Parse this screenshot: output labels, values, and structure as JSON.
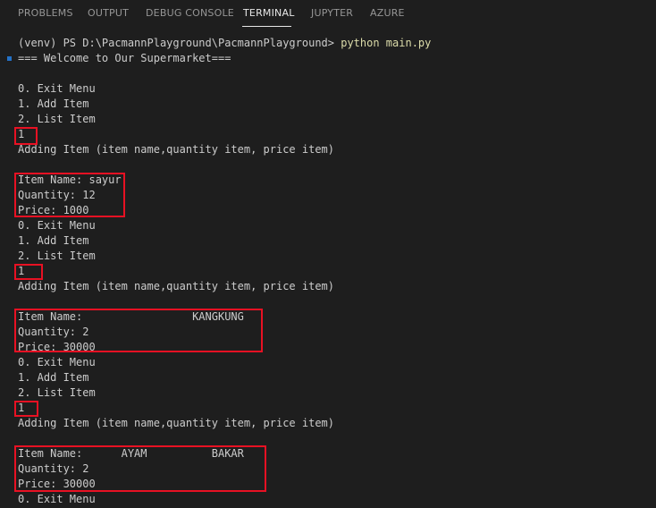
{
  "tabs": [
    {
      "label": "PROBLEMS",
      "active": false
    },
    {
      "label": "OUTPUT",
      "active": false
    },
    {
      "label": "DEBUG CONSOLE",
      "active": false
    },
    {
      "label": "TERMINAL",
      "active": true
    },
    {
      "label": "JUPYTER",
      "active": false
    },
    {
      "label": "AZURE",
      "active": false
    }
  ],
  "terminal": {
    "prompt": "(venv) PS D:\\PacmannPlayground\\PacmannPlayground> ",
    "command": "python main.py",
    "lines": [
      "=== Welcome to Our Supermarket===",
      "",
      "0. Exit Menu",
      "1. Add Item",
      "2. List Item",
      "1",
      "Adding Item (item name,quantity item, price item)",
      "",
      "Item Name: sayur",
      "Quantity: 12",
      "Price: 1000",
      "0. Exit Menu",
      "1. Add Item",
      "2. List Item",
      "1",
      "Adding Item (item name,quantity item, price item)",
      "",
      "Item Name:                 KANGKUNG",
      "Quantity: 2",
      "Price: 30000",
      "0. Exit Menu",
      "1. Add Item",
      "2. List Item",
      "1",
      "Adding Item (item name,quantity item, price item)",
      "",
      "Item Name:      AYAM          BAKAR",
      "Quantity: 2",
      "Price: 30000",
      "0. Exit Menu"
    ]
  },
  "colors": {
    "background": "#1e1e1e",
    "text": "#cccccc",
    "command": "#dcdcaa",
    "highlight_box": "#e81123",
    "active_tab": "#e7e7e7",
    "inactive_tab": "#969696"
  }
}
